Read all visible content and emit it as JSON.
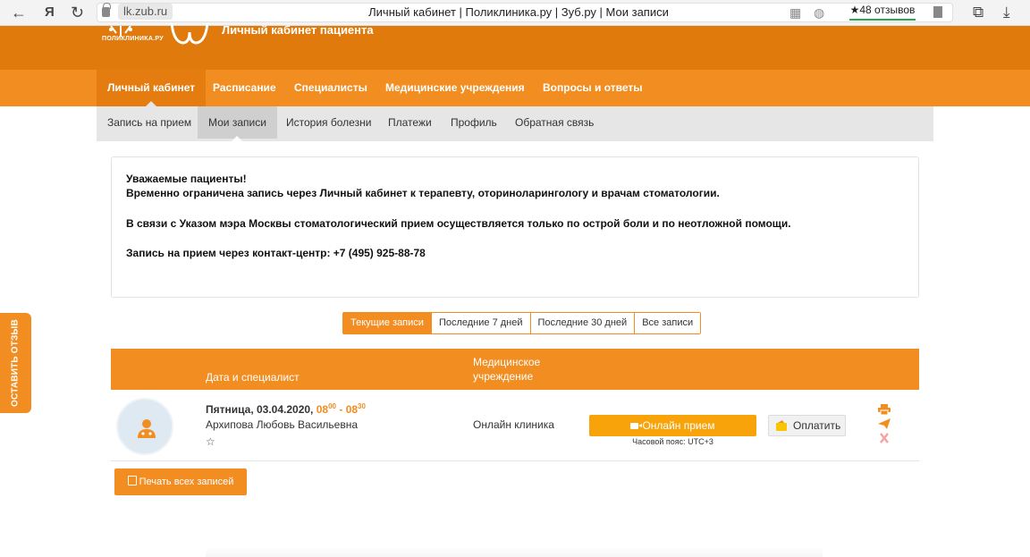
{
  "browser": {
    "back_icon": "←",
    "yandex_icon": "Я",
    "reload_icon": "↻",
    "url_host": "lk.zub.ru",
    "page_title": "Личный кабинет | Поликлиника.ру | Зуб.ру | Мои записи",
    "reviews_label": "★48 отзывов",
    "reviews_accent": "#2ca84d"
  },
  "header": {
    "logo_caption": "ПОЛИКЛИНИКА.РУ",
    "cabinet_title": "Личный кабинет пациента",
    "brand_color": "#e07a0c",
    "accent_color": "#f28d22"
  },
  "main_nav": {
    "items": [
      {
        "label": "Личный кабинет",
        "active": true
      },
      {
        "label": "Расписание",
        "active": false
      },
      {
        "label": "Специалисты",
        "active": false
      },
      {
        "label": "Медицинские учреждения",
        "active": false
      },
      {
        "label": "Вопросы и ответы",
        "active": false
      }
    ]
  },
  "sub_nav": {
    "items": [
      {
        "label": "Запись на прием",
        "active": false
      },
      {
        "label": "Мои записи",
        "active": true
      },
      {
        "label": "История болезни",
        "active": false
      },
      {
        "label": "Платежи",
        "active": false
      },
      {
        "label": "Профиль",
        "active": false
      },
      {
        "label": "Обратная связь",
        "active": false
      }
    ]
  },
  "feedback_tab": {
    "label": "ОСТАВИТЬ ОТЗЫВ"
  },
  "notice": {
    "line1": "Уважаемые пациенты!",
    "line2": "Временно ограничена запись через Личный кабинет к терапевту, оториноларингологу и врачам стоматологии.",
    "line3": "В связи с Указом мэра Москвы стоматологический прием осуществляется только по острой боли и по неотложной помощи.",
    "line4": "Запись на прием через контакт-центр: +7 (495) 925-88-78"
  },
  "filters": {
    "items": [
      {
        "label": "Текущие записи",
        "active": true
      },
      {
        "label": "Последние 7 дней",
        "active": false
      },
      {
        "label": "Последние 30 дней",
        "active": false
      },
      {
        "label": "Все записи",
        "active": false
      }
    ]
  },
  "table": {
    "col_date": "Дата и специалист",
    "col_clinic_line1": "Медицинское",
    "col_clinic_line2": "учреждение",
    "rows": [
      {
        "date_prefix": "Пятница, 03.04.2020,",
        "time_start_h": "08",
        "time_start_m": "00",
        "time_sep": "-",
        "time_end_h": "08",
        "time_end_m": "30",
        "doctor": "Архипова Любовь Васильевна",
        "favorite_icon": "☆",
        "clinic": "Онлайн клиника",
        "online_button": "Онлайн прием",
        "timezone": "Часовой пояс: UTC+3",
        "pay_button": "Оплатить",
        "actions": [
          "print-icon",
          "send-icon",
          "cancel-icon"
        ]
      }
    ]
  },
  "print_all_button": "Печать всех записей"
}
